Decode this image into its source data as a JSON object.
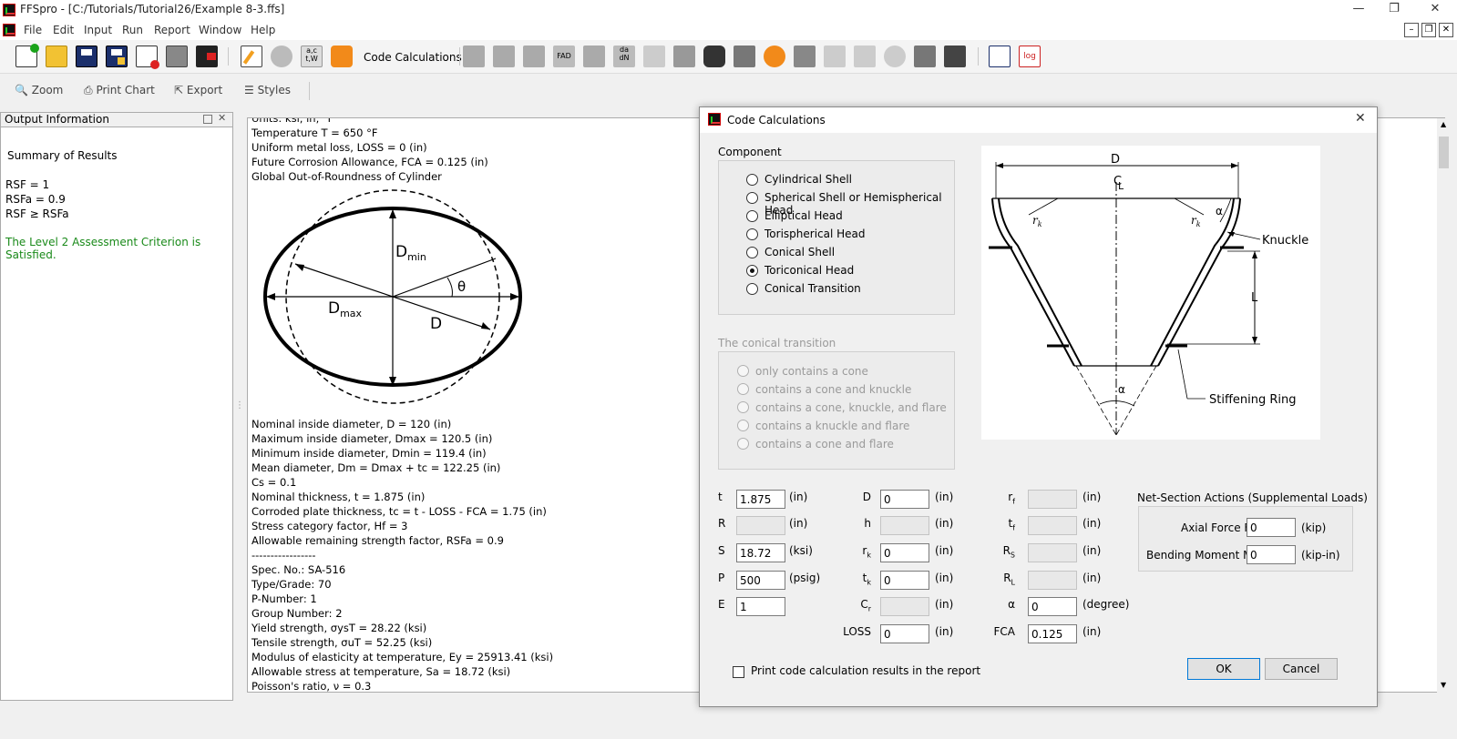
{
  "window": {
    "title": "FFSpro - [C:/Tutorials/Tutorial26/Example 8-3.ffs]",
    "minimize": "—",
    "restore": "❐",
    "close": "✕"
  },
  "menu": [
    "File",
    "Edit",
    "Input",
    "Run",
    "Report",
    "Window",
    "Help"
  ],
  "toolbar": {
    "code_calculations": "Code Calculations"
  },
  "chart_toolbar": {
    "zoom": "Zoom",
    "print_chart": "Print Chart",
    "export": "Export",
    "styles": "Styles"
  },
  "output_panel": {
    "title": "Output Information",
    "summary": "Summary of Results",
    "rsf": "RSF = 1",
    "rsfa": "RSFa = 0.9",
    "rsf_cmp": "RSF ≥ RSFa",
    "criterion": "The Level 2 Assessment Criterion is Satisfied.",
    "criterion_color": "#1a8a1a"
  },
  "doc": {
    "top_lines": [
      "Units: ksi, in, °F",
      "Temperature T = 650 °F",
      "Uniform metal loss, LOSS = 0 (in)",
      "Future Corrosion Allowance, FCA = 0.125 (in)",
      "Global Out-of-Roundness of Cylinder"
    ],
    "figure": {
      "dmin": "Dmin",
      "dmax": "Dmax",
      "d": "D",
      "theta": "θ"
    },
    "lines": [
      "Nominal inside diameter, D = 120 (in)",
      "Maximum inside diameter, Dmax = 120.5 (in)",
      "Minimum inside diameter, Dmin = 119.4 (in)",
      "Mean diameter, Dm = Dmax + tc = 122.25 (in)",
      "Cs = 0.1",
      "Nominal thickness, t = 1.875 (in)",
      "Corroded plate thickness, tc = t - LOSS - FCA = 1.75 (in)",
      "Stress category factor, Hf = 3",
      "Allowable remaining strength factor, RSFa = 0.9",
      "-----------------",
      "Spec. No.: SA-516",
      "Type/Grade: 70",
      "P-Number: 1",
      "Group Number: 2",
      "Yield strength, σysT = 28.22 (ksi)",
      "Tensile strength, σuT = 52.25 (ksi)",
      "Modulus of elasticity at temperature, Ey = 25913.41 (ksi)",
      "Allowable stress at temperature, Sa = 18.72 (ksi)",
      "Poisson's ratio, ν = 0.3"
    ]
  },
  "dialog": {
    "title": "Code Calculations",
    "component_label": "Component",
    "components": [
      "Cylindrical Shell",
      "Spherical Shell or Hemispherical Head",
      "Elliptical Head",
      "Torispherical Head",
      "Conical Shell",
      "Toriconical Head",
      "Conical Transition"
    ],
    "selected_component": 5,
    "transition_label": "The conical transition",
    "transitions": [
      "only contains a cone",
      "contains a cone and knuckle",
      "contains a cone, knuckle, and flare",
      "contains a knuckle and flare",
      "contains a cone and flare"
    ],
    "diagram": {
      "d": "D",
      "cl": "C",
      "cl2": "L",
      "rk": "r",
      "rk_sub": "k",
      "alpha": "α",
      "knuckle": "Knuckle",
      "l": "L",
      "ring": "Stiffening Ring"
    },
    "fields": {
      "t": {
        "label": "t",
        "value": "1.875",
        "unit": "(in)"
      },
      "R": {
        "label": "R",
        "value": "",
        "unit": "(in)"
      },
      "S": {
        "label": "S",
        "value": "18.72",
        "unit": "(ksi)"
      },
      "P": {
        "label": "P",
        "value": "500",
        "unit": "(psig)"
      },
      "E": {
        "label": "E",
        "value": "1"
      },
      "D": {
        "label": "D",
        "value": "0",
        "unit": "(in)"
      },
      "h": {
        "label": "h",
        "value": "",
        "unit": "(in)"
      },
      "rk": {
        "label": "r",
        "sub": "k",
        "value": "0",
        "unit": "(in)"
      },
      "tk": {
        "label": "t",
        "sub": "k",
        "value": "0",
        "unit": "(in)"
      },
      "Cr": {
        "label": "C",
        "sub": "r",
        "value": "",
        "unit": "(in)"
      },
      "LOSS": {
        "label": "LOSS",
        "value": "0",
        "unit": "(in)"
      },
      "rf": {
        "label": "r",
        "sub": "f",
        "value": "",
        "unit": "(in)"
      },
      "tf": {
        "label": "t",
        "sub": "f",
        "value": "",
        "unit": "(in)"
      },
      "RS": {
        "label": "R",
        "sub": "S",
        "value": "",
        "unit": "(in)"
      },
      "RL": {
        "label": "R",
        "sub": "L",
        "value": "",
        "unit": "(in)"
      },
      "alpha": {
        "label": "α",
        "value": "0",
        "unit": "(degree)"
      },
      "FCA": {
        "label": "FCA",
        "value": "0.125",
        "unit": "(in)"
      }
    },
    "net_section": {
      "title": "Net-Section Actions (Supplemental Loads)",
      "axial_label": "Axial Force F",
      "axial_value": "0",
      "axial_unit": "(kip)",
      "moment_label": "Bending Moment M",
      "moment_value": "0",
      "moment_unit": "(kip-in)"
    },
    "print_checkbox": "Print code calculation results in the report",
    "ok": "OK",
    "cancel": "Cancel"
  }
}
